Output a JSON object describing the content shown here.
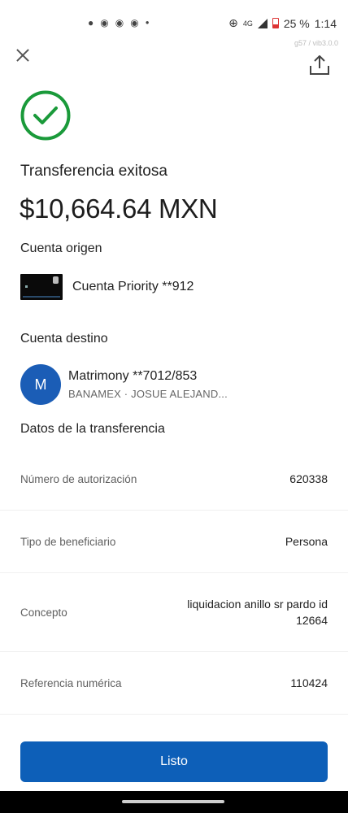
{
  "status_bar": {
    "network": "4G",
    "battery": "25 %",
    "time": "1:14",
    "notification_icons": [
      "chat-bubble-icon",
      "eye-icon",
      "eye-icon",
      "eye-icon",
      "dot-icon"
    ]
  },
  "version_text": "g57 / vib3.0.0",
  "header": {
    "close_icon": "close-icon",
    "share_icon": "share-icon"
  },
  "success_color": "#1a9a3a",
  "title": "Transferencia exitosa",
  "amount": "$10,664.64 MXN",
  "origin": {
    "label": "Cuenta origen",
    "account_name": "Cuenta Priority **912"
  },
  "destination": {
    "label": "Cuenta destino",
    "avatar_letter": "M",
    "avatar_color": "#1b5db6",
    "account_name": "Matrimony **7012/853",
    "subtitle": "BANAMEX · JOSUE ALEJAND..."
  },
  "details": {
    "label": "Datos de la transferencia",
    "rows": [
      {
        "label": "Número de autorización",
        "value": "620338"
      },
      {
        "label": "Tipo de beneficiario",
        "value": "Persona"
      },
      {
        "label": "Concepto",
        "value": "liquidacion anillo sr pardo id 12664"
      },
      {
        "label": "Referencia numérica",
        "value": "110424"
      }
    ]
  },
  "done_button": {
    "label": "Listo",
    "color": "#0d5fb8"
  }
}
